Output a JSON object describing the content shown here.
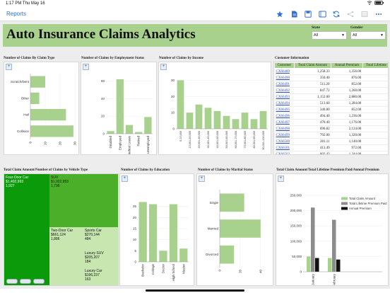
{
  "status": {
    "time": "1:17 PM",
    "date": "Thu May 16"
  },
  "nav": {
    "back_label": "Reports",
    "toolbar_icons": [
      "star-icon",
      "document-icon",
      "save-icon",
      "tablet-icon",
      "refresh-icon",
      "share-icon",
      "grid-icon",
      "more-icon"
    ]
  },
  "colors": {
    "header_bg": "#a9d18e",
    "bar": "#a9d18e",
    "treemap_dark": "#0a9a0a",
    "treemap_mid": "#4caf2a",
    "treemap_light": "#c8e6b0",
    "accent": "#2f6fd6"
  },
  "header": {
    "title": "Auto Insurance Claims Analytics",
    "state_label": "State",
    "state_value": "All",
    "gender_label": "Gender",
    "gender_value": "All"
  },
  "charts": {
    "claim_type": {
      "title": "Number of Claims By Claim Type"
    },
    "employment": {
      "title": "Number of Claims by Employment Status"
    },
    "income": {
      "title": "Number of Claims by Income"
    },
    "vehicle": {
      "title": "Total Claim Amount/Number of Claims by Vehicle Type"
    },
    "education": {
      "title": "Number of Claims by Education"
    },
    "marital": {
      "title": "Number of Claims by Marital Status"
    },
    "premium": {
      "title": "Total Claim Amount/Total Lifetime Premium Paid/Annual Premium"
    }
  },
  "chart_data": [
    {
      "type": "bar",
      "orientation": "horizontal",
      "title": "Number of Claims By Claim Type",
      "categories": [
        "Scratch/Dent",
        "Other",
        "Hail",
        "Collision"
      ],
      "values": [
        10,
        6,
        24,
        29
      ],
      "xlim": [
        0,
        30
      ],
      "xticks": [
        "0",
        "10",
        "20",
        "30"
      ]
    },
    {
      "type": "bar",
      "title": "Number of Claims by Employment Status",
      "categories": [
        "Disabled",
        "Employed",
        "Medical Leave",
        "Retired",
        "Unemployed"
      ],
      "values": [
        3,
        62,
        10,
        2,
        19
      ],
      "ylim": [
        0,
        70
      ],
      "yticks": [
        "0",
        "20",
        "40",
        "60"
      ]
    },
    {
      "type": "bar",
      "title": "Number of Claims by Income",
      "categories": [
        "0-10,000",
        "10,001-20,000",
        "20,001-30,000",
        "30,001-40,000",
        "40,001-50,000",
        "50,001-60,000",
        "60,001-70,000",
        "70,001-80,000",
        "80,001-90,000",
        "90,001-100,000"
      ],
      "values": [
        30,
        10,
        15,
        13,
        11,
        8,
        6,
        10,
        6,
        11
      ],
      "ylim": [
        0,
        35
      ],
      "yticks": [
        "0",
        "10",
        "20",
        "30"
      ]
    },
    {
      "type": "bar",
      "title": "Number of Claims by Education",
      "categories": [
        "Bachelor",
        "College",
        "Doctor",
        "High School",
        "Master"
      ],
      "values": [
        27,
        26,
        5,
        26,
        6
      ],
      "ylim": [
        0,
        30
      ],
      "yticks": [
        "0",
        "5",
        "10",
        "15",
        "20",
        "25"
      ]
    },
    {
      "type": "bar",
      "orientation": "horizontal",
      "title": "Number of Claims by Marital Status",
      "categories": [
        "Single",
        "Married",
        "Divorced"
      ],
      "values": [
        24,
        40,
        14
      ],
      "xlim": [
        0,
        45
      ],
      "xticks": [
        "0",
        "20",
        "40"
      ]
    },
    {
      "type": "bar",
      "title": "Total Claim Amount/Total Lifetime Premium Paid/Annual Premium",
      "categories": [
        "January",
        "February"
      ],
      "series": [
        {
          "name": "Total Claim Amount",
          "values": [
            50000,
            45000
          ]
        },
        {
          "name": "Total Lifetime Premium Paid",
          "values": [
            210000,
            170000
          ]
        },
        {
          "name": "Annual Premium",
          "values": [
            45000,
            40000
          ]
        }
      ],
      "ylim": [
        0,
        250000
      ],
      "yticks": [
        "0",
        "50,000",
        "100,000",
        "150,000",
        "200,000",
        "250,000"
      ],
      "legend": "top-right"
    },
    {
      "type": "treemap",
      "title": "Total Claim Amount/Number of Claims by Vehicle Type",
      "items": [
        {
          "name": "Four-Door Car",
          "amount": "$1,402,993",
          "count": "1,927"
        },
        {
          "name": "SUV",
          "amount": "$1,022,953",
          "count": "1,796"
        },
        {
          "name": "Two-Door Car",
          "amount": "$661,124",
          "count": "1,886"
        },
        {
          "name": "Sports Car",
          "amount": "$270,144",
          "count": "484"
        },
        {
          "name": "Luxury SUV",
          "amount": "$205,207",
          "count": "184"
        },
        {
          "name": "Luxury Car",
          "amount": "$196,237",
          "count": "163"
        }
      ]
    }
  ],
  "customer_table": {
    "title": "Customer Information",
    "headers": [
      "Customer",
      "Total Claim Amount",
      "Annual Premium",
      "Total Lifetime"
    ],
    "rows": [
      [
        "CX66489",
        "1,258.33",
        "1,356.00"
      ],
      [
        "CX66490",
        "350.40",
        "876.00"
      ],
      [
        "CX66491",
        "511.20",
        "852.00"
      ],
      [
        "CX66492",
        "847.72",
        "1,260.00"
      ],
      [
        "CX66493",
        "1,152.00",
        "2,880.00"
      ],
      [
        "CX66494",
        "513.60",
        "1,284.00"
      ],
      [
        "CX66495",
        "340.80",
        "852.00"
      ],
      [
        "CX66496",
        "494.40",
        "1,236.00"
      ],
      [
        "CX66497",
        "470.40",
        "1,176.00"
      ],
      [
        "CX66498",
        "696.82",
        "2,124.00"
      ],
      [
        "CX66499",
        "792.00",
        "1,320.00"
      ],
      [
        "CX66500",
        "281.11",
        "1,140.00"
      ],
      [
        "CX66501",
        "413.49",
        "972.00"
      ],
      [
        "CX66502",
        "602.43",
        "1,344.00"
      ],
      [
        "CX66503",
        "842.39",
        "1,572.00"
      ]
    ]
  }
}
